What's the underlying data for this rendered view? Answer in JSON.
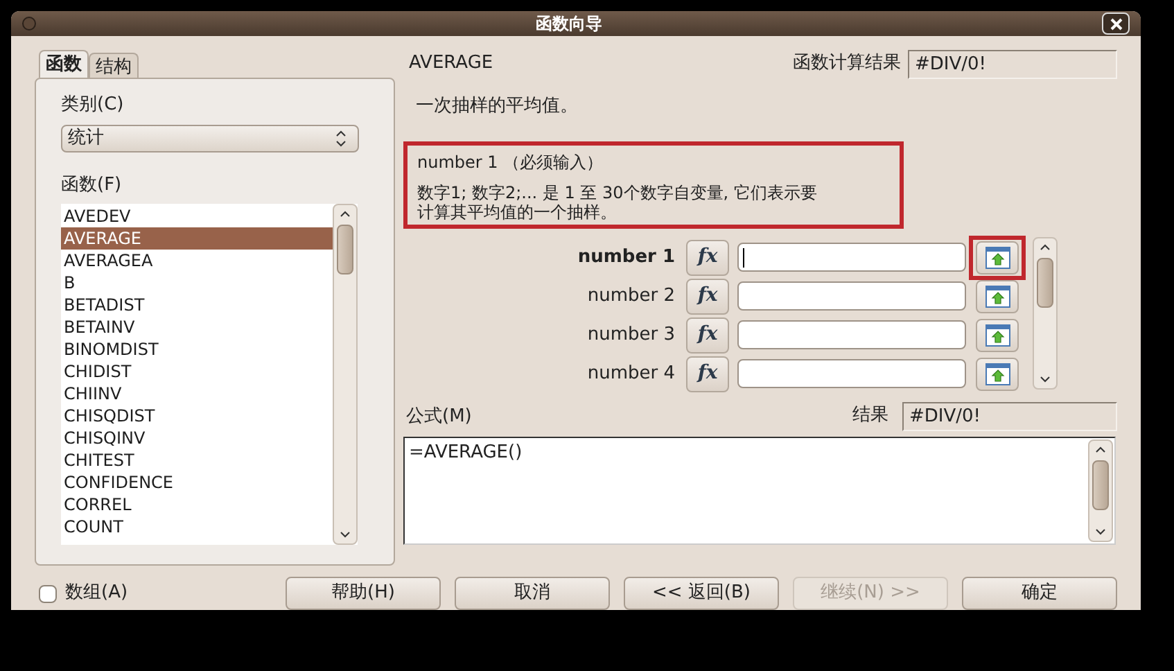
{
  "window": {
    "title": "函数向导"
  },
  "tabs": [
    {
      "label": "函数",
      "selected": true
    },
    {
      "label": "结构",
      "selected": false
    }
  ],
  "category": {
    "label": "类别(C)",
    "value": "统计"
  },
  "functions": {
    "label": "函数(F)",
    "items": [
      {
        "name": "AVEDEV",
        "selected": false
      },
      {
        "name": "AVERAGE",
        "selected": true
      },
      {
        "name": "AVERAGEA",
        "selected": false
      },
      {
        "name": "B",
        "selected": false
      },
      {
        "name": "BETADIST",
        "selected": false
      },
      {
        "name": "BETAINV",
        "selected": false
      },
      {
        "name": "BINOMDIST",
        "selected": false
      },
      {
        "name": "CHIDIST",
        "selected": false
      },
      {
        "name": "CHIINV",
        "selected": false
      },
      {
        "name": "CHISQDIST",
        "selected": false
      },
      {
        "name": "CHISQINV",
        "selected": false
      },
      {
        "name": "CHITEST",
        "selected": false
      },
      {
        "name": "CONFIDENCE",
        "selected": false
      },
      {
        "name": "CORREL",
        "selected": false
      },
      {
        "name": "COUNT",
        "selected": false
      }
    ]
  },
  "array_option": {
    "label": "数组(A)",
    "checked": false
  },
  "function_name": "AVERAGE",
  "function_result": {
    "label": "函数计算结果",
    "value": "#DIV/0!"
  },
  "description": "一次抽样的平均值。",
  "argument_help": {
    "title": "number 1 （必须输入）",
    "text": "数字1; 数字2;... 是 1 至 30个数字自变量, 它们表示要计算其平均值的一个抽样。"
  },
  "arguments": [
    {
      "label": "number 1",
      "fx": "fx",
      "selected": true,
      "highlighted": true
    },
    {
      "label": "number 2",
      "fx": "fx",
      "selected": false,
      "highlighted": false
    },
    {
      "label": "number 3",
      "fx": "fx",
      "selected": false,
      "highlighted": false
    },
    {
      "label": "number 4",
      "fx": "fx",
      "selected": false,
      "highlighted": false
    }
  ],
  "formula": {
    "label": "公式(M)",
    "value": "=AVERAGE()",
    "result_label": "结果",
    "result_value": "#DIV/0!"
  },
  "buttons": [
    {
      "label": "帮助(H)",
      "disabled": false
    },
    {
      "label": "取消",
      "disabled": false
    },
    {
      "label": "<< 返回(B)",
      "disabled": false
    },
    {
      "label": "继续(N) >>",
      "disabled": true
    },
    {
      "label": "确定",
      "disabled": false
    }
  ]
}
